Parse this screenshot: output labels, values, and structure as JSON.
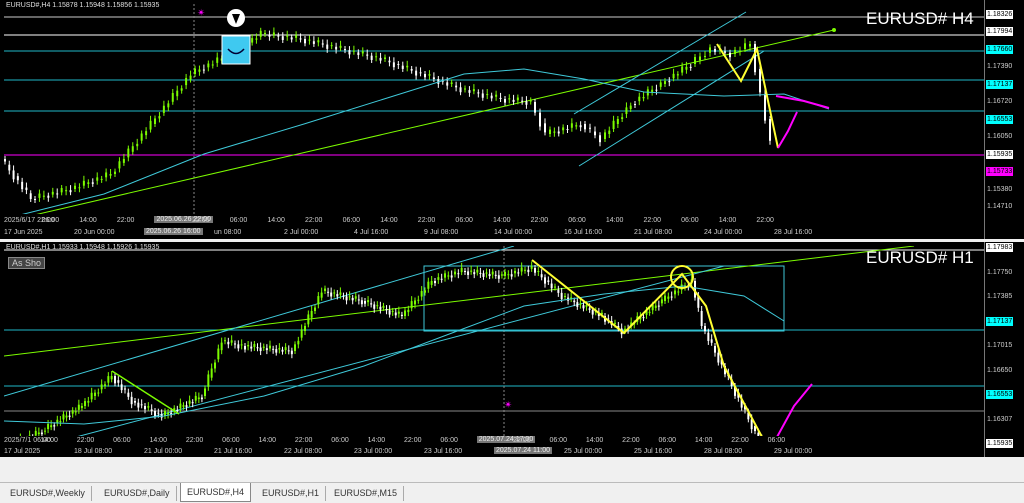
{
  "top": {
    "header": "EURUSD#,H4  1.15878 1.15948 1.15856 1.15935",
    "title": "EURUSD# H4",
    "price_labels": [
      {
        "text": "1.18326",
        "hl": "#ffffff"
      },
      {
        "text": "1.17994",
        "hl": "#ffffff"
      },
      {
        "text": "1.17660",
        "hl": "#00ffff"
      },
      {
        "text": "1.17390",
        "hl": ""
      },
      {
        "text": "1.17137",
        "hl": "#00ffff"
      },
      {
        "text": "1.16720",
        "hl": ""
      },
      {
        "text": "1.16553",
        "hl": "#00ffff"
      },
      {
        "text": "1.16050",
        "hl": ""
      },
      {
        "text": "1.15935",
        "hl": "#ffffff"
      },
      {
        "text": "1.15733",
        "hl": "#ff00ff"
      },
      {
        "text": "1.15380",
        "hl": ""
      },
      {
        "text": "1.14710",
        "hl": ""
      }
    ],
    "time_labels_upper": [
      {
        "text": "2025/6/17 22:00",
        "hl": false
      },
      {
        "text": "06:00",
        "hl": false
      },
      {
        "text": "14:00",
        "hl": false
      },
      {
        "text": "22:00",
        "hl": false
      },
      {
        "text": "2025.06.26 22:00",
        "hl": true
      },
      {
        "text": "22:00",
        "hl": false
      },
      {
        "text": "06:00",
        "hl": false
      },
      {
        "text": "14:00",
        "hl": false
      },
      {
        "text": "22:00",
        "hl": false
      },
      {
        "text": "06:00",
        "hl": false
      },
      {
        "text": "14:00",
        "hl": false
      },
      {
        "text": "22:00",
        "hl": false
      },
      {
        "text": "06:00",
        "hl": false
      },
      {
        "text": "14:00",
        "hl": false
      },
      {
        "text": "22:00",
        "hl": false
      },
      {
        "text": "06:00",
        "hl": false
      },
      {
        "text": "14:00",
        "hl": false
      },
      {
        "text": "22:00",
        "hl": false
      },
      {
        "text": "06:00",
        "hl": false
      },
      {
        "text": "14:00",
        "hl": false
      },
      {
        "text": "22:00",
        "hl": false
      }
    ],
    "time_labels": [
      {
        "text": "17 Jun 2025",
        "hl": false
      },
      {
        "text": "20 Jun 00:00",
        "hl": false
      },
      {
        "text": "2025.06.26 16:00",
        "hl": true
      },
      {
        "text": "un 08:00",
        "hl": false
      },
      {
        "text": "2 Jul 00:00",
        "hl": false
      },
      {
        "text": "4 Jul 16:00",
        "hl": false
      },
      {
        "text": "9 Jul 08:00",
        "hl": false
      },
      {
        "text": "14 Jul 00:00",
        "hl": false
      },
      {
        "text": "16 Jul 16:00",
        "hl": false
      },
      {
        "text": "21 Jul 08:00",
        "hl": false
      },
      {
        "text": "24 Jul 00:00",
        "hl": false
      },
      {
        "text": "28 Jul 16:00",
        "hl": false
      }
    ]
  },
  "bottom": {
    "header": "EURUSD#,H1  1.15933 1.15948 1.15926 1.15935",
    "title": "EURUSD# H1",
    "as_show": "As Sho",
    "price_labels": [
      {
        "text": "1.17983",
        "hl": "#ffffff"
      },
      {
        "text": "1.17750",
        "hl": ""
      },
      {
        "text": "1.17385",
        "hl": ""
      },
      {
        "text": "1.17137",
        "hl": "#00ffff"
      },
      {
        "text": "1.17015",
        "hl": ""
      },
      {
        "text": "1.16650",
        "hl": ""
      },
      {
        "text": "1.16553",
        "hl": "#00ffff"
      },
      {
        "text": "1.16307",
        "hl": ""
      },
      {
        "text": "1.15935",
        "hl": "#ffffff"
      }
    ],
    "time_labels_upper": [
      {
        "text": "2025/7/1 06:00",
        "hl": false
      },
      {
        "text": "14:00",
        "hl": false
      },
      {
        "text": "22:00",
        "hl": false
      },
      {
        "text": "06:00",
        "hl": false
      },
      {
        "text": "14:00",
        "hl": false
      },
      {
        "text": "22:00",
        "hl": false
      },
      {
        "text": "06:00",
        "hl": false
      },
      {
        "text": "14:00",
        "hl": false
      },
      {
        "text": "22:00",
        "hl": false
      },
      {
        "text": "06:00",
        "hl": false
      },
      {
        "text": "14:00",
        "hl": false
      },
      {
        "text": "22:00",
        "hl": false
      },
      {
        "text": "06:00",
        "hl": false
      },
      {
        "text": "2025.07.24 17:00",
        "hl": true
      },
      {
        "text": "22:00",
        "hl": false
      },
      {
        "text": "06:00",
        "hl": false
      },
      {
        "text": "14:00",
        "hl": false
      },
      {
        "text": "22:00",
        "hl": false
      },
      {
        "text": "06:00",
        "hl": false
      },
      {
        "text": "14:00",
        "hl": false
      },
      {
        "text": "22:00",
        "hl": false
      },
      {
        "text": "06:00",
        "hl": false
      }
    ],
    "time_labels": [
      {
        "text": "17 Jul 2025",
        "hl": false
      },
      {
        "text": "18 Jul 08:00",
        "hl": false
      },
      {
        "text": "21 Jul 00:00",
        "hl": false
      },
      {
        "text": "21 Jul 16:00",
        "hl": false
      },
      {
        "text": "22 Jul 08:00",
        "hl": false
      },
      {
        "text": "23 Jul 00:00",
        "hl": false
      },
      {
        "text": "23 Jul 16:00",
        "hl": false
      },
      {
        "text": "2025.07.24 11:00",
        "hl": true
      },
      {
        "text": "25 Jul 00:00",
        "hl": false
      },
      {
        "text": "25 Jul 16:00",
        "hl": false
      },
      {
        "text": "28 Jul 08:00",
        "hl": false
      },
      {
        "text": "29 Jul 00:00",
        "hl": false
      }
    ]
  },
  "tabs": [
    {
      "label": "EURUSD#,Weekly",
      "active": false
    },
    {
      "label": "EURUSD#,Daily",
      "active": false
    },
    {
      "label": "EURUSD#,H4",
      "active": true
    },
    {
      "label": "EURUSD#,H1",
      "active": false
    },
    {
      "label": "EURUSD#,M15",
      "active": false
    }
  ],
  "colors": {
    "background": "#000000",
    "bull": "#7cfc00",
    "bear": "#ffffff",
    "moving_average": "#3fc9d9",
    "level_line": "#20b8c8",
    "trendline": "#7cfc00",
    "zigzag": "#ffff33",
    "projection": "#ff00ff"
  }
}
